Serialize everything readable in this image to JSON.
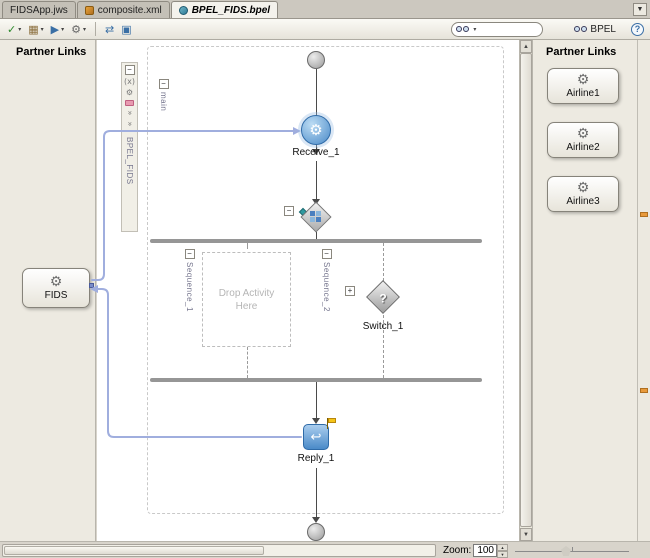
{
  "tabs": {
    "items": [
      {
        "label": "FIDSApp.jws"
      },
      {
        "label": "composite.xml"
      },
      {
        "label": "BPEL_FIDS.bpel"
      }
    ]
  },
  "toolbar": {
    "bpel_selector": "BPEL",
    "help": "?"
  },
  "icons": {
    "gear": "⚙",
    "check": "✓",
    "dropdown": "▾",
    "overflow": "▼",
    "build": "▦",
    "run": "▶",
    "swap": "⇄",
    "grid": "▣",
    "variables": "(x)",
    "chevrons": "»",
    "reply": "↩",
    "question": "?",
    "collapse": "−",
    "expand": "+",
    "up": "▲",
    "down": "▼"
  },
  "left_panel": {
    "title": "Partner Links",
    "partner_links": [
      {
        "label": "FIDS"
      }
    ]
  },
  "right_panel": {
    "title": "Partner Links",
    "partner_links": [
      {
        "label": "Airline1"
      },
      {
        "label": "Airline2"
      },
      {
        "label": "Airline3"
      }
    ]
  },
  "diagram": {
    "scope_tab": "BPEL_FIDS",
    "sequence_tab": "main",
    "receive_label": "Receive_1",
    "switch_label": "Switch_1",
    "reply_label": "Reply_1",
    "sequence1_label": "Sequence_1",
    "sequence2_label": "Sequence_2",
    "drop_hint": "Drop Activity Here"
  },
  "statusbar": {
    "zoom_label": "Zoom:",
    "zoom_value": "100"
  }
}
